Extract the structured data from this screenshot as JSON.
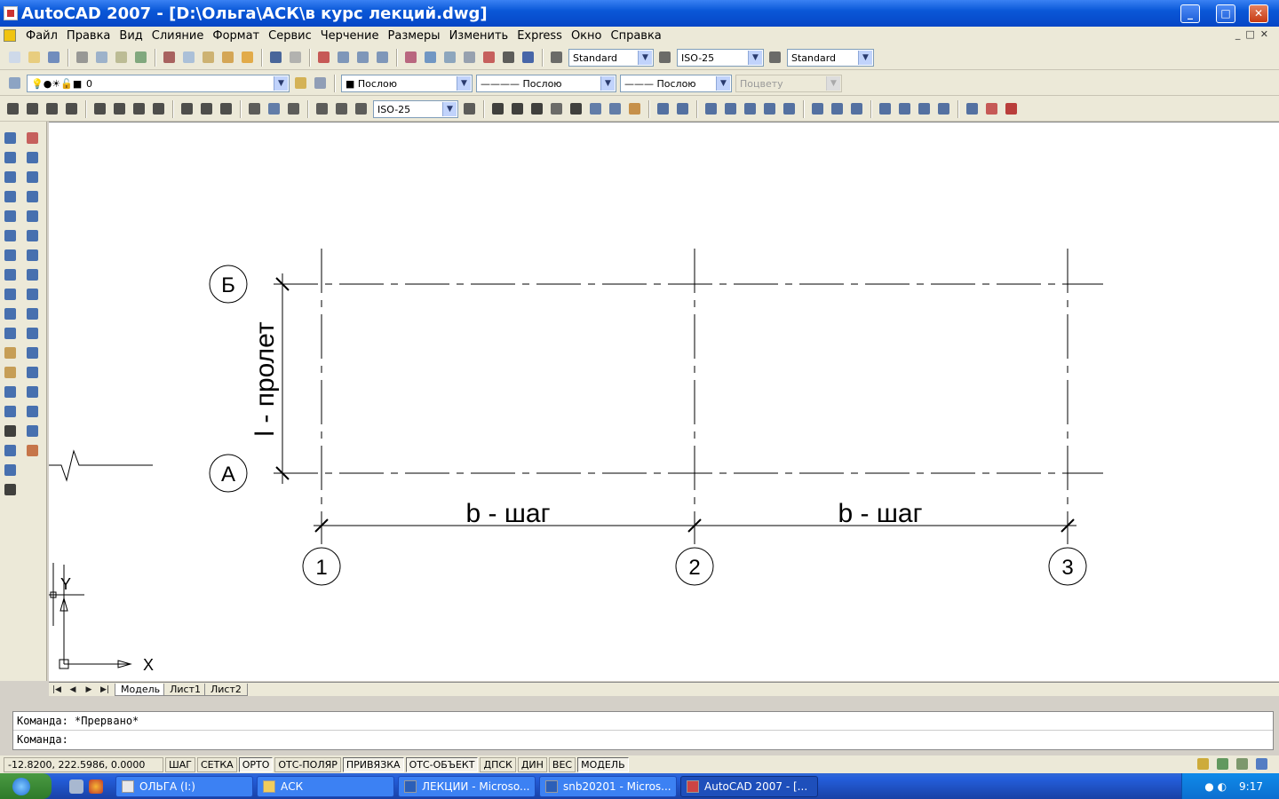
{
  "window": {
    "title": "AutoCAD 2007 - [D:\\Ольга\\АСК\\в курс лекций.dwg]",
    "min": "_",
    "max": "□",
    "close": "✕"
  },
  "menu": [
    "Файл",
    "Правка",
    "Вид",
    "Слияние",
    "Формат",
    "Сервис",
    "Черчение",
    "Размеры",
    "Изменить",
    "Express",
    "Окно",
    "Справка"
  ],
  "toolbar1": {
    "textstyle": "Standard",
    "dimstyle": "ISO-25",
    "tablestyle": "Standard"
  },
  "toolbar2": {
    "layer": "0",
    "color": "■ Послою",
    "linetype": "———— Послою",
    "lineweight": "——— Послою",
    "plotstyle": "Поцвету"
  },
  "toolbar3": {
    "dimstyle": "ISO-25"
  },
  "drawing": {
    "axes_horizontal": [
      {
        "label": "Б"
      },
      {
        "label": "А"
      }
    ],
    "axes_vertical": [
      {
        "label": "1"
      },
      {
        "label": "2"
      },
      {
        "label": "3"
      }
    ],
    "dim_vertical": "l - пролет",
    "dim_bottom": [
      "b - шаг",
      "b - шаг"
    ],
    "ucs_x": "X",
    "ucs_y": "Y"
  },
  "tabs": {
    "model": "Модель",
    "sheet1": "Лист1",
    "sheet2": "Лист2"
  },
  "command": {
    "line1": "Команда: *Прервано*",
    "line2": "Команда:"
  },
  "status": {
    "coords": "-12.8200, 222.5986, 0.0000",
    "buttons": [
      "ШАГ",
      "СЕТКА",
      "ОРТО",
      "ОТС-ПОЛЯР",
      "ПРИВЯЗКА",
      "ОТС-ОБЪЕКТ",
      "ДПСК",
      "ДИН",
      "ВЕС",
      "МОДЕЛЬ"
    ]
  },
  "taskbar": {
    "items": [
      {
        "label": "ОЛЬГА (I:)"
      },
      {
        "label": "АСК"
      },
      {
        "label": "ЛЕКЦИИ - Microso..."
      },
      {
        "label": "snb20201 - Micros..."
      },
      {
        "label": "AutoCAD 2007 - [..."
      }
    ],
    "clock": "9:17"
  }
}
